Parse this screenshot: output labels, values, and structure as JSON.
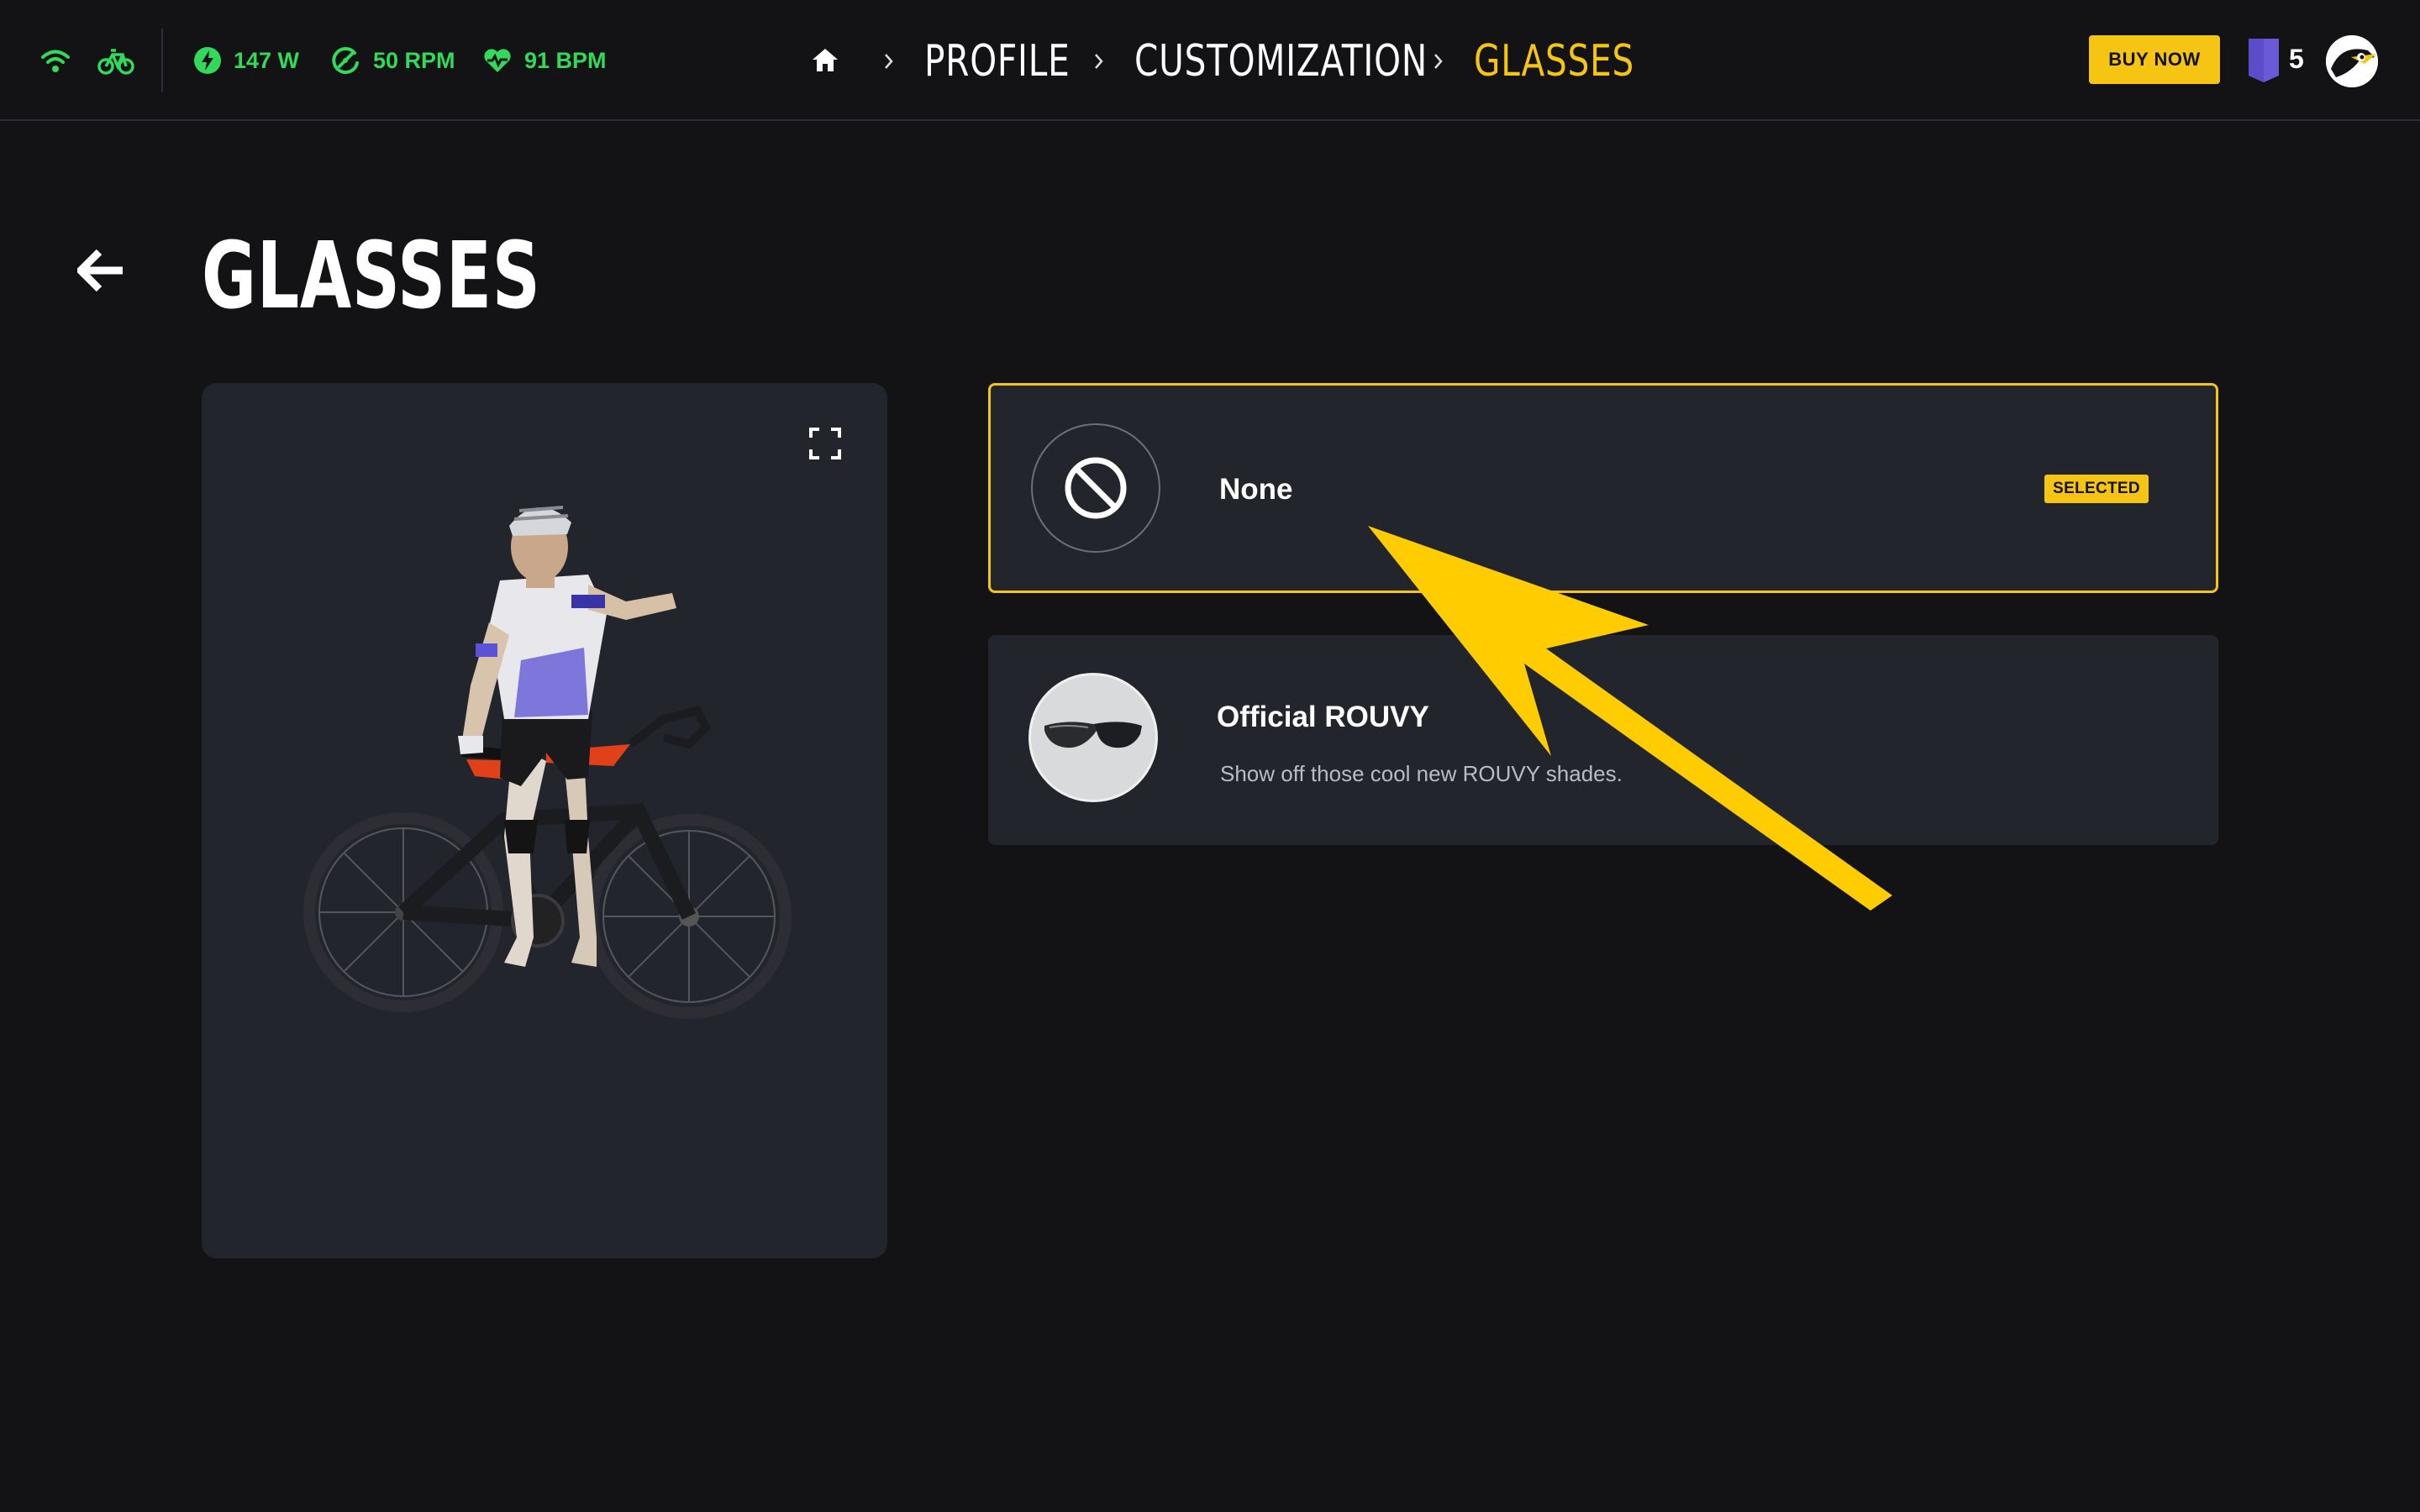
{
  "header": {
    "metrics": [
      {
        "icon": "power-bolt-icon",
        "value": "147 W"
      },
      {
        "icon": "cadence-icon",
        "value": "50 RPM"
      },
      {
        "icon": "heart-rate-icon",
        "value": "91 BPM"
      }
    ],
    "breadcrumb": [
      "PROFILE",
      "CUSTOMIZATION",
      "GLASSES"
    ],
    "buy_label": "BUY NOW",
    "badge_count": "5",
    "accent_color": "#f6c412",
    "metric_color": "#33d95a"
  },
  "page": {
    "title": "GLASSES"
  },
  "options": [
    {
      "title": "None",
      "badge": "SELECTED",
      "selected": true
    },
    {
      "title": "Official ROUVY",
      "description": "Show off those cool new ROUVY shades.",
      "selected": false
    }
  ]
}
